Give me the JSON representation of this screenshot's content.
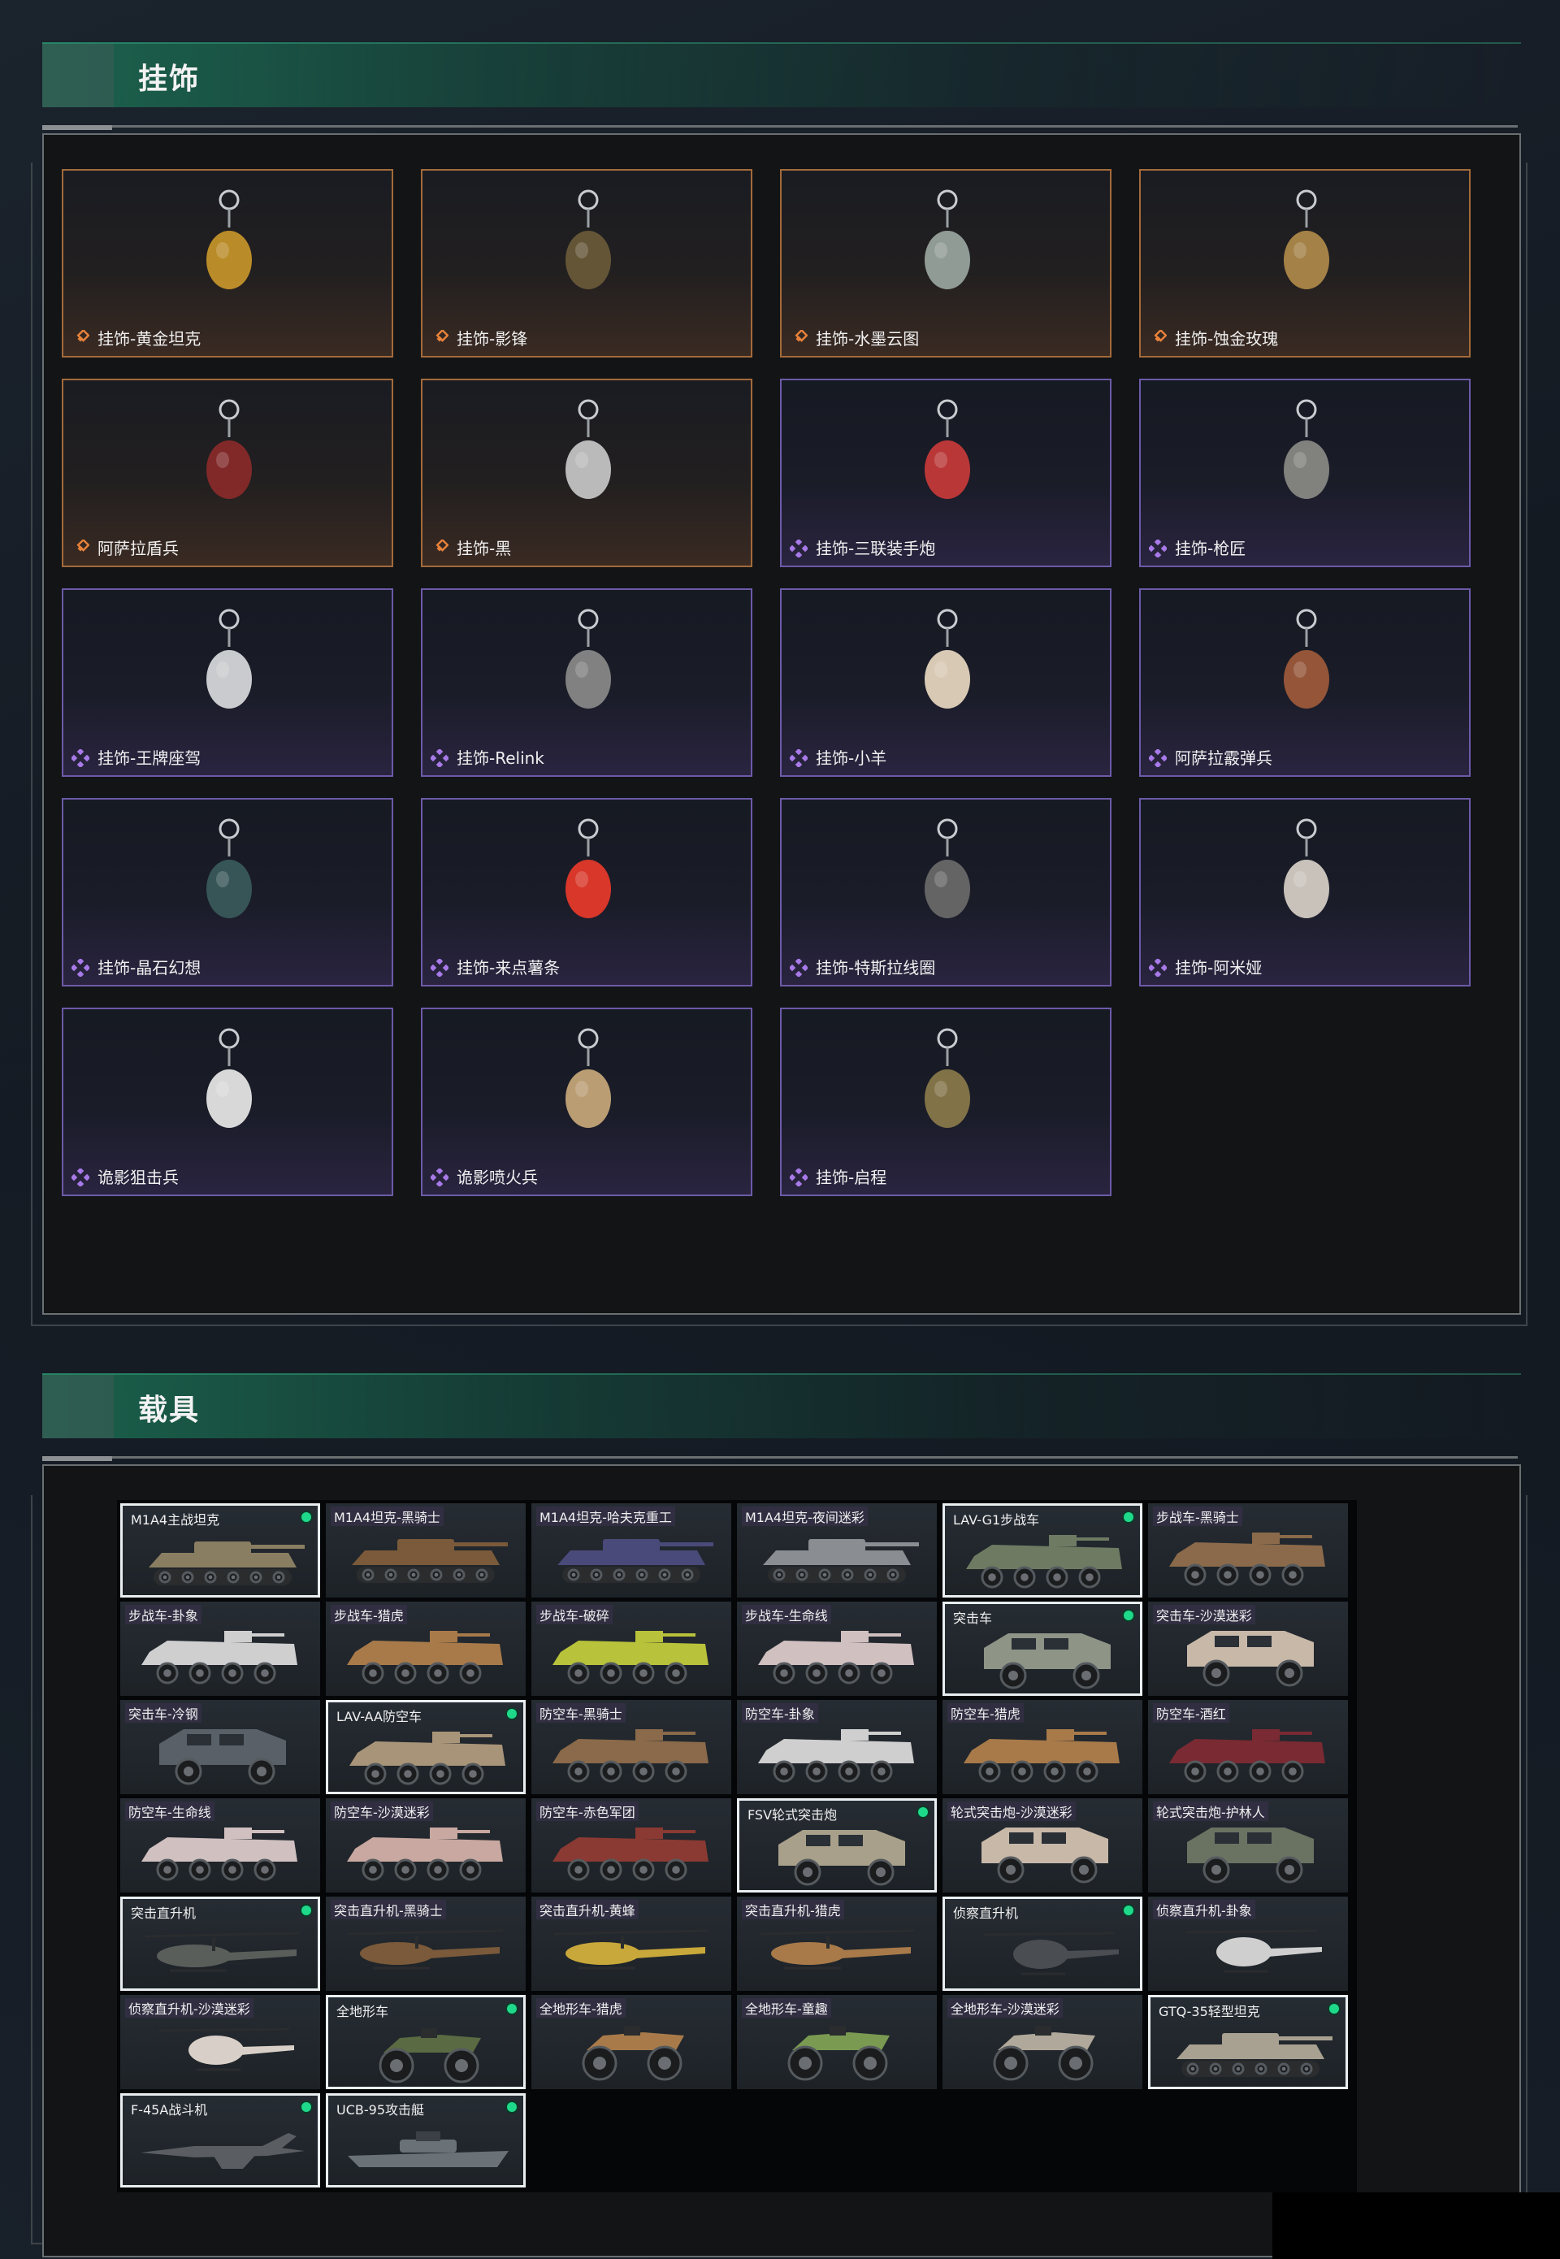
{
  "sections": {
    "pendants": {
      "title": "挂饰"
    },
    "vehicles": {
      "title": "载具"
    }
  },
  "pendants": [
    {
      "name": "挂饰-黄金坦克",
      "rarity": "gold",
      "icon": "gold-tank-charm-icon"
    },
    {
      "name": "挂饰-影锋",
      "rarity": "gold",
      "icon": "shadow-blade-charm-icon"
    },
    {
      "name": "挂饰-水墨云图",
      "rarity": "gold",
      "icon": "ink-orb-charm-icon"
    },
    {
      "name": "挂饰-蚀金玫瑰",
      "rarity": "gold",
      "icon": "gold-rose-charm-icon"
    },
    {
      "name": "阿萨拉盾兵",
      "rarity": "gold",
      "icon": "shield-soldier-charm-icon"
    },
    {
      "name": "挂饰-黑",
      "rarity": "gold",
      "icon": "black-blade-charm-icon"
    },
    {
      "name": "挂饰-三联装手炮",
      "rarity": "purple",
      "icon": "triple-cannon-charm-icon"
    },
    {
      "name": "挂饰-枪匠",
      "rarity": "purple",
      "icon": "gunsmith-charm-icon"
    },
    {
      "name": "挂饰-王牌座驾",
      "rarity": "purple",
      "icon": "jet-charm-icon"
    },
    {
      "name": "挂饰-Relink",
      "rarity": "purple",
      "icon": "relink-charm-icon"
    },
    {
      "name": "挂饰-小羊",
      "rarity": "purple",
      "icon": "lamb-charm-icon"
    },
    {
      "name": "阿萨拉霰弹兵",
      "rarity": "purple",
      "icon": "shotgunner-charm-icon"
    },
    {
      "name": "挂饰-晶石幻想",
      "rarity": "purple",
      "icon": "crystal-charm-icon"
    },
    {
      "name": "挂饰-来点薯条",
      "rarity": "purple",
      "icon": "fries-charm-icon"
    },
    {
      "name": "挂饰-特斯拉线圈",
      "rarity": "purple",
      "icon": "tesla-coil-charm-icon"
    },
    {
      "name": "挂饰-阿米娅",
      "rarity": "purple",
      "icon": "bunny-charm-icon"
    },
    {
      "name": "诡影狙击兵",
      "rarity": "purple",
      "icon": "sniper-charm-icon"
    },
    {
      "name": "诡影喷火兵",
      "rarity": "purple",
      "icon": "flamer-charm-icon"
    },
    {
      "name": "挂饰-启程",
      "rarity": "purple",
      "icon": "departure-charm-icon"
    }
  ],
  "vehicles": [
    {
      "name": "M1A4主战坦克",
      "selected": true,
      "equipped": true,
      "kind": "tank",
      "color": "#8a7e62"
    },
    {
      "name": "M1A4坦克-黑骑士",
      "selected": false,
      "equipped": false,
      "kind": "tank",
      "color": "#7a5a3a"
    },
    {
      "name": "M1A4坦克-哈夫克重工",
      "selected": false,
      "equipped": false,
      "kind": "tank",
      "color": "#4a4a7a"
    },
    {
      "name": "M1A4坦克-夜间迷彩",
      "selected": false,
      "equipped": false,
      "kind": "tank",
      "color": "#8a8e92"
    },
    {
      "name": "LAV-G1步战车",
      "selected": true,
      "equipped": true,
      "kind": "apc",
      "color": "#6e7a62"
    },
    {
      "name": "步战车-黑骑士",
      "selected": false,
      "equipped": false,
      "kind": "apc",
      "color": "#8a6a4a"
    },
    {
      "name": "步战车-卦象",
      "selected": false,
      "equipped": false,
      "kind": "apc",
      "color": "#cfcfcf"
    },
    {
      "name": "步战车-猎虎",
      "selected": false,
      "equipped": false,
      "kind": "apc",
      "color": "#a87a4a"
    },
    {
      "name": "步战车-破碎",
      "selected": false,
      "equipped": false,
      "kind": "apc",
      "color": "#b8c23a"
    },
    {
      "name": "步战车-生命线",
      "selected": false,
      "equipped": false,
      "kind": "apc",
      "color": "#d0c0c0"
    },
    {
      "name": "突击车",
      "selected": true,
      "equipped": true,
      "kind": "mrap",
      "color": "#8e9486"
    },
    {
      "name": "突击车-沙漠迷彩",
      "selected": false,
      "equipped": false,
      "kind": "mrap",
      "color": "#c8b8a8"
    },
    {
      "name": "突击车-冷钢",
      "selected": false,
      "equipped": false,
      "kind": "mrap",
      "color": "#5a6068"
    },
    {
      "name": "LAV-AA防空车",
      "selected": true,
      "equipped": true,
      "kind": "apc",
      "color": "#a89478"
    },
    {
      "name": "防空车-黑骑士",
      "selected": false,
      "equipped": false,
      "kind": "apc",
      "color": "#8a6a4a"
    },
    {
      "name": "防空车-卦象",
      "selected": false,
      "equipped": false,
      "kind": "apc",
      "color": "#cfcfcf"
    },
    {
      "name": "防空车-猎虎",
      "selected": false,
      "equipped": false,
      "kind": "apc",
      "color": "#a87a4a"
    },
    {
      "name": "防空车-酒红",
      "selected": false,
      "equipped": false,
      "kind": "apc",
      "color": "#7a2a32"
    },
    {
      "name": "防空车-生命线",
      "selected": false,
      "equipped": false,
      "kind": "apc",
      "color": "#d0c0c0"
    },
    {
      "name": "防空车-沙漠迷彩",
      "selected": false,
      "equipped": false,
      "kind": "apc",
      "color": "#c8a8a0"
    },
    {
      "name": "防空车-赤色军团",
      "selected": false,
      "equipped": false,
      "kind": "apc",
      "color": "#8a3a32"
    },
    {
      "name": "FSV轮式突击炮",
      "selected": true,
      "equipped": true,
      "kind": "mrap",
      "color": "#a8a08a"
    },
    {
      "name": "轮式突击炮-沙漠迷彩",
      "selected": false,
      "equipped": false,
      "kind": "mrap",
      "color": "#c8b8a8"
    },
    {
      "name": "轮式突击炮-护林人",
      "selected": false,
      "equipped": false,
      "kind": "mrap",
      "color": "#6a7262"
    },
    {
      "name": "突击直升机",
      "selected": true,
      "equipped": true,
      "kind": "heli",
      "color": "#5a5e5a"
    },
    {
      "name": "突击直升机-黑骑士",
      "selected": false,
      "equipped": false,
      "kind": "heli",
      "color": "#7a5a3a"
    },
    {
      "name": "突击直升机-黄蜂",
      "selected": false,
      "equipped": false,
      "kind": "heli",
      "color": "#c8a83a"
    },
    {
      "name": "突击直升机-猎虎",
      "selected": false,
      "equipped": false,
      "kind": "heli",
      "color": "#a87a4a"
    },
    {
      "name": "侦察直升机",
      "selected": true,
      "equipped": true,
      "kind": "scout",
      "color": "#4a4e52"
    },
    {
      "name": "侦察直升机-卦象",
      "selected": false,
      "equipped": false,
      "kind": "scout",
      "color": "#cfcfcf"
    },
    {
      "name": "侦察直升机-沙漠迷彩",
      "selected": false,
      "equipped": false,
      "kind": "scout",
      "color": "#d8d0c8"
    },
    {
      "name": "全地形车",
      "selected": true,
      "equipped": true,
      "kind": "atv",
      "color": "#5a6a42"
    },
    {
      "name": "全地形车-猎虎",
      "selected": false,
      "equipped": false,
      "kind": "atv",
      "color": "#a87a4a"
    },
    {
      "name": "全地形车-童趣",
      "selected": false,
      "equipped": false,
      "kind": "atv",
      "color": "#7a9a52"
    },
    {
      "name": "全地形车-沙漠迷彩",
      "selected": false,
      "equipped": false,
      "kind": "atv",
      "color": "#b0a89a"
    },
    {
      "name": "GTQ-35轻型坦克",
      "selected": true,
      "equipped": true,
      "kind": "tank",
      "color": "#a8a090"
    },
    {
      "name": "F-45A战斗机",
      "selected": true,
      "equipped": true,
      "kind": "jet",
      "color": "#5a5e62"
    },
    {
      "name": "UCB-95攻击艇",
      "selected": true,
      "equipped": true,
      "kind": "boat",
      "color": "#6a7278"
    }
  ],
  "colors": {
    "gold_rarity": "#e8823a",
    "purple_rarity": "#a77ae8",
    "equipped_dot": "#1fd98a",
    "header_green": "#1c7858"
  }
}
